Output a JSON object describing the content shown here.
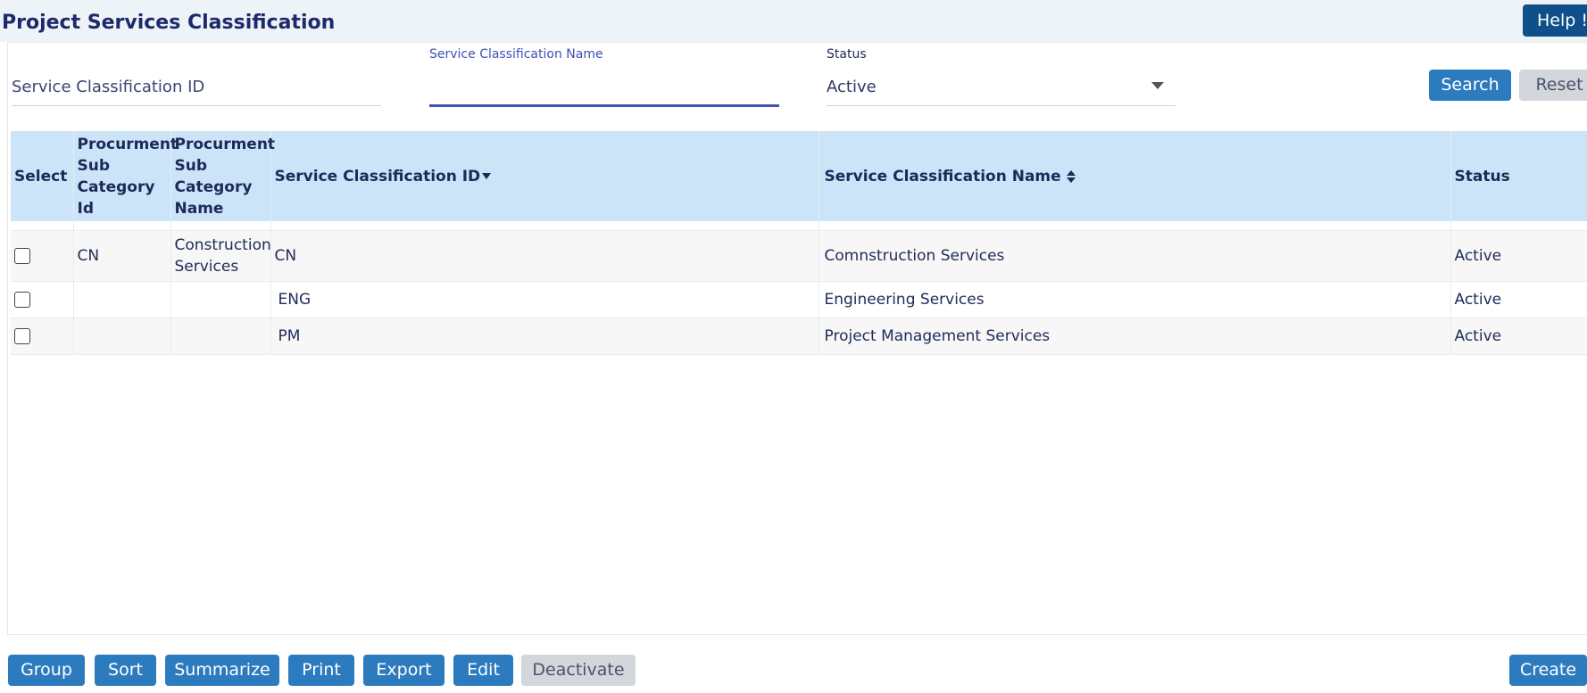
{
  "header": {
    "title": "Project Services Classification",
    "help_label": "Help !"
  },
  "filters": {
    "service_id": {
      "placeholder": "Service Classification ID",
      "value": ""
    },
    "service_name": {
      "label": "Service Classification Name",
      "value": ""
    },
    "status": {
      "label": "Status",
      "value": "Active"
    },
    "search_label": "Search",
    "reset_label": "Reset"
  },
  "table": {
    "columns": {
      "select": "Select",
      "sub_cat_id": "Procurment Sub Category Id",
      "sub_cat_name": "Procurment Sub Category Name",
      "service_id": "Service Classification ID",
      "service_name": "Service Classification Name",
      "status": "Status"
    },
    "rows": [
      {
        "sub_cat_id": "CN",
        "sub_cat_name": "Construction Services",
        "service_id": "CN",
        "service_name": "Comnstruction Services",
        "status": "Active"
      },
      {
        "sub_cat_id": "",
        "sub_cat_name": "",
        "service_id": "ENG",
        "service_name": "Engineering Services",
        "status": "Active"
      },
      {
        "sub_cat_id": "",
        "sub_cat_name": "",
        "service_id": "PM",
        "service_name": "Project Management Services",
        "status": "Active"
      }
    ]
  },
  "footer": {
    "group": "Group",
    "sort": "Sort",
    "summarize": "Summarize",
    "print": "Print",
    "export": "Export",
    "edit": "Edit",
    "deactivate": "Deactivate",
    "create": "Create"
  }
}
